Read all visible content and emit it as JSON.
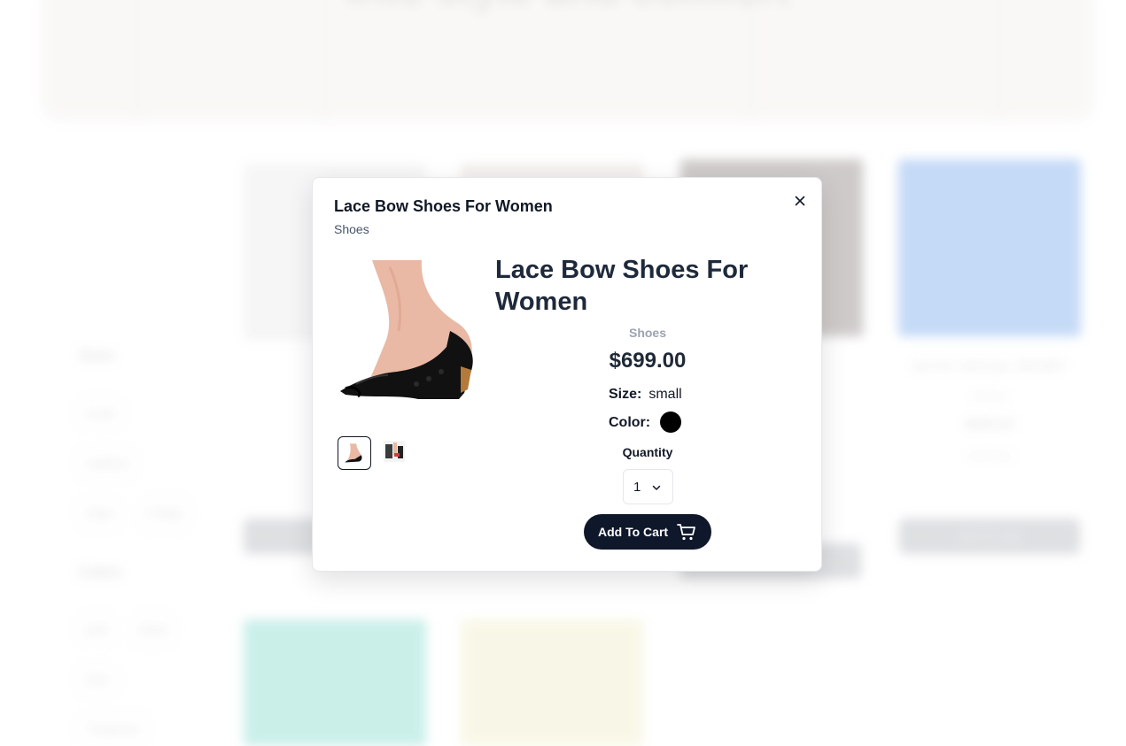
{
  "background": {
    "banner_text": "into style and comfort",
    "filters": {
      "sizes_heading": "Sizes",
      "sizes": [
        "small",
        "medium",
        "large",
        "X-large"
      ],
      "colors_heading": "Colors",
      "colors": [
        "pink",
        "black",
        "blue",
        "Turquoise"
      ]
    },
    "cards": [
      {
        "title": "",
        "category": "",
        "price": "",
        "button": ""
      },
      {
        "title": "ACTIV SPCIAL SPORT",
        "category": "Shoes",
        "price": "$699.00",
        "quantity_label": "Quantity",
        "button": "Add To Cart"
      }
    ]
  },
  "modal": {
    "header_title": "Lace Bow Shoes For Women",
    "header_category": "Shoes",
    "title": "Lace Bow Shoes For Women",
    "category": "Shoes",
    "price": "$699.00",
    "size_label": "Size:",
    "size_value": "small",
    "color_label": "Color:",
    "color_value": "#000000",
    "quantity_label": "Quantity",
    "quantity_value": "1",
    "add_to_cart_label": "Add To Cart",
    "icons": {
      "close": "close-icon",
      "chevron": "chevron-down-icon",
      "cart": "cart-icon"
    }
  }
}
